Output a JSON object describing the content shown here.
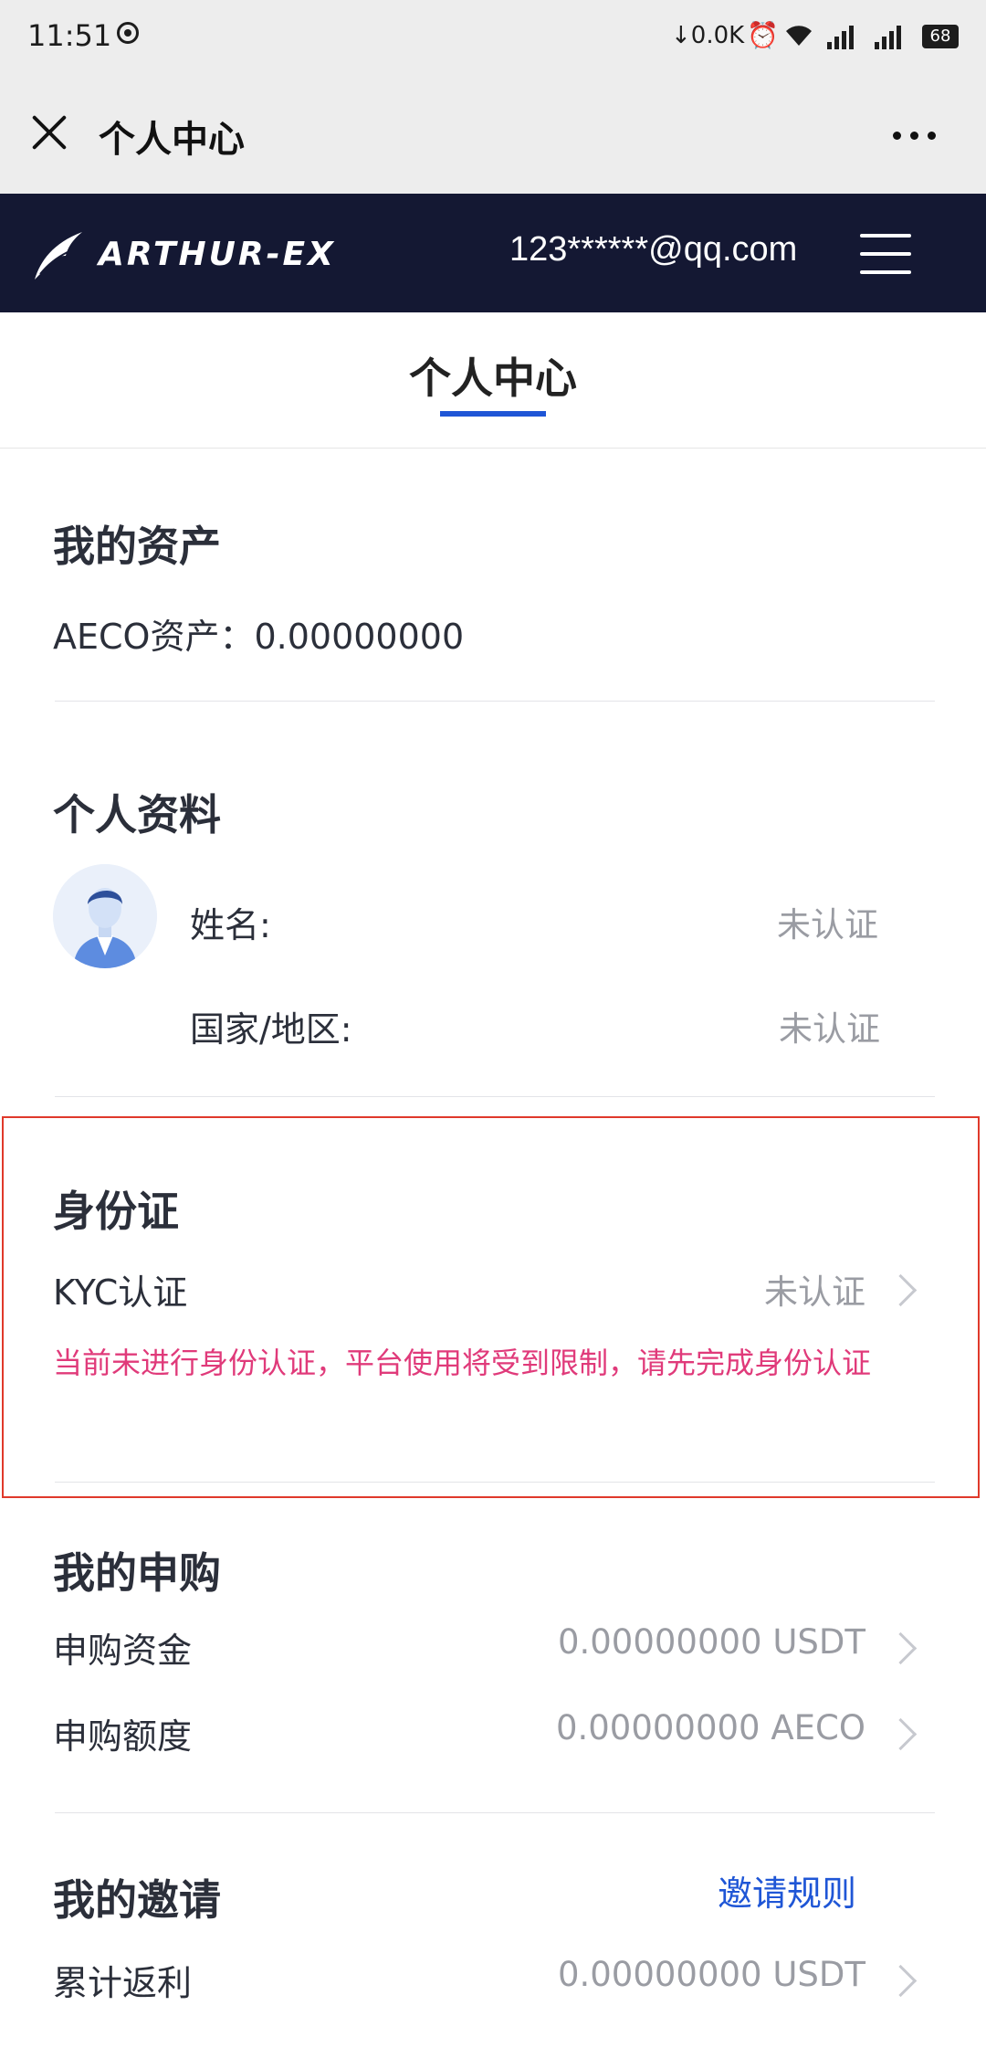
{
  "status_bar": {
    "time": "11:51",
    "net_speed": "↓0.0K",
    "battery": "68",
    "icons": [
      "record-icon",
      "alarm-icon",
      "wifi-icon",
      "signal-icon",
      "signal-icon"
    ]
  },
  "wechat_bar": {
    "title": "个人中心"
  },
  "app_header": {
    "logo_text": "ARTHUR-EX",
    "email": "123******@qq.com"
  },
  "page_tab": {
    "label": "个人中心"
  },
  "assets": {
    "title": "我的资产",
    "aeco_label": "AECO资产：",
    "aeco_value": "0.00000000"
  },
  "profile": {
    "title": "个人资料",
    "name_label": "姓名:",
    "name_value": "未认证",
    "country_label": "国家/地区:",
    "country_value": "未认证"
  },
  "identity": {
    "title": "身份证",
    "kyc_label": "KYC认证",
    "kyc_value": "未认证",
    "warning": "当前未进行身份认证，平台使用将受到限制，请先完成身份认证"
  },
  "subscription": {
    "title": "我的申购",
    "funds_label": "申购资金",
    "funds_value": "0.00000000 USDT",
    "quota_label": "申购额度",
    "quota_value": "0.00000000 AECO"
  },
  "invite": {
    "title": "我的邀请",
    "rules_link": "邀请规则",
    "rebate_label": "累计返利",
    "rebate_value": "0.00000000 USDT"
  },
  "colors": {
    "header_bg": "#141833",
    "accent_blue": "#1f56d6",
    "warning_pink": "#e03a7a",
    "highlight_red": "#e0392b"
  }
}
